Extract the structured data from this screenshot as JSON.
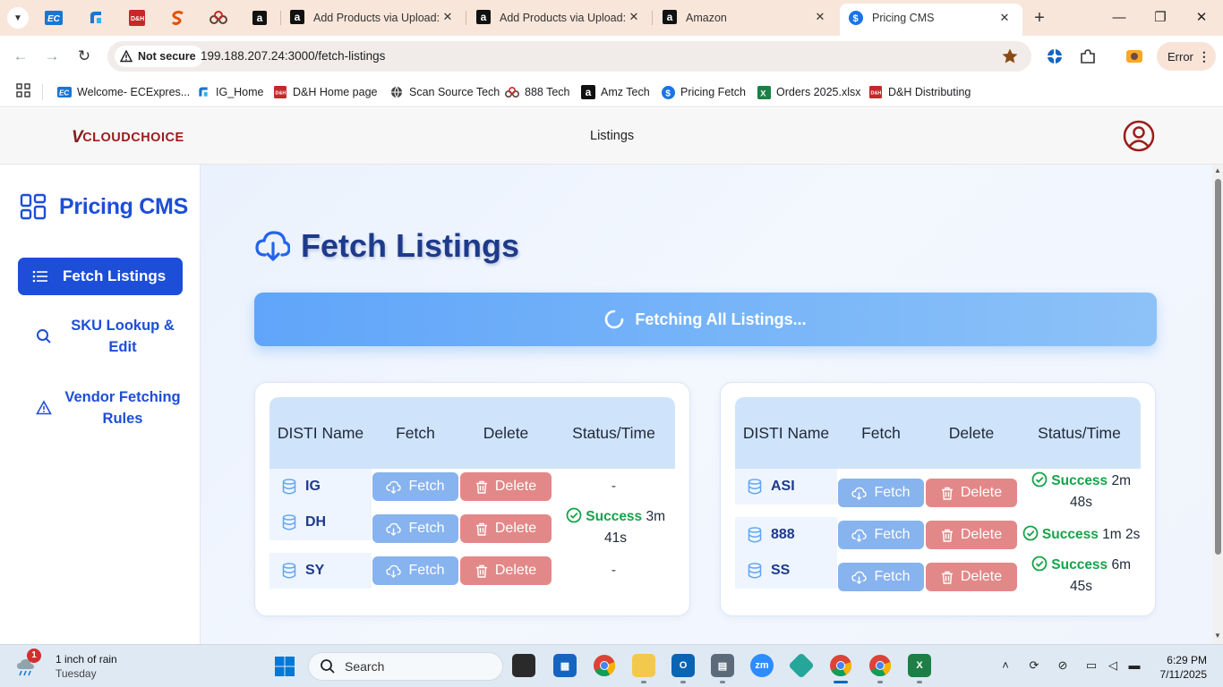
{
  "browser": {
    "tabs": [
      {
        "title": "Add Products via Upload:",
        "favicon": "amazon"
      },
      {
        "title": "Add Products via Upload:",
        "favicon": "amazon"
      },
      {
        "title": "Amazon",
        "favicon": "amazon"
      },
      {
        "title": "Pricing CMS",
        "favicon": "dollar",
        "active": true
      }
    ],
    "pinned_tabs": [
      "ec-express",
      "ingram",
      "dh",
      "scansource",
      "888",
      "amazon"
    ],
    "security_label": "Not secure",
    "url": "199.188.207.24:3000/fetch-listings",
    "profile_label": "Error",
    "bookmarks": [
      {
        "label": "Welcome- ECExpres...",
        "icon": "ec-icon"
      },
      {
        "label": "IG_Home",
        "icon": "ig-icon"
      },
      {
        "label": "D&H Home page",
        "icon": "dh-icon"
      },
      {
        "label": "Scan Source Tech",
        "icon": "globe-icon"
      },
      {
        "label": "888 Tech",
        "icon": "888-icon"
      },
      {
        "label": "Amz Tech",
        "icon": "amazon-icon"
      },
      {
        "label": "Pricing Fetch",
        "icon": "dollar-icon"
      },
      {
        "label": "Orders 2025.xlsx",
        "icon": "excel-icon"
      },
      {
        "label": "D&H Distributing",
        "icon": "dh-icon"
      }
    ]
  },
  "header": {
    "logo_text": "CLOUDCHOICE",
    "logo_mark": "V",
    "nav_label": "Listings"
  },
  "sidebar": {
    "brand": "Pricing CMS",
    "items": [
      {
        "label": "Fetch Listings",
        "icon": "list-icon",
        "active": true
      },
      {
        "label": "SKU Lookup & Edit",
        "icon": "search-icon"
      },
      {
        "label": "Vendor Fetching Rules",
        "icon": "warning-icon"
      }
    ]
  },
  "main": {
    "title": "Fetch Listings",
    "fetch_all_label": "Fetching All Listings...",
    "columns": {
      "disti": "DISTI Name",
      "fetch": "Fetch",
      "delete": "Delete",
      "status": "Status/Time"
    },
    "fetch_label": "Fetch",
    "delete_label": "Delete",
    "tables": [
      {
        "rows": [
          {
            "name": "IG",
            "status": "-",
            "time": ""
          },
          {
            "name": "DH",
            "status": "Success",
            "time": "3m 41s"
          },
          {
            "name": "SY",
            "status": "-",
            "time": ""
          }
        ]
      },
      {
        "rows": [
          {
            "name": "ASI",
            "status": "Success",
            "time": "2m 48s"
          },
          {
            "name": "888",
            "status": "Success",
            "time": "1m 2s"
          },
          {
            "name": "SS",
            "status": "Success",
            "time": "6m 45s"
          }
        ]
      }
    ]
  },
  "taskbar": {
    "weather_title": "1 inch of rain",
    "weather_day": "Tuesday",
    "weather_badge": "1",
    "search_placeholder": "Search",
    "time": "6:29 PM",
    "date": "7/11/2025"
  },
  "colors": {
    "primary": "#1d4ed8",
    "title": "#1e3a8a",
    "fetch_button": "#87b3ee",
    "delete_button": "#e38888",
    "success": "#16a34a",
    "tab_strip": "#f9e6da"
  }
}
